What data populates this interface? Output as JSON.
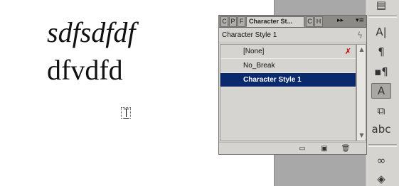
{
  "document": {
    "line1": "sdfsdfdf",
    "line2": "dfvdfd"
  },
  "panel": {
    "tabs": [
      {
        "label": "C"
      },
      {
        "label": "P"
      },
      {
        "label": "F"
      },
      {
        "label": "Character St..."
      },
      {
        "label": "C"
      },
      {
        "label": "H"
      }
    ],
    "expand_glyph": "▸▸",
    "menu_glyph": "▾≡",
    "current_style": "Character Style 1",
    "quick_apply_icon": "lightning-icon",
    "styles": [
      {
        "label": "[None]",
        "selected": false,
        "locked": true
      },
      {
        "label": "No_Break",
        "selected": false
      },
      {
        "label": "Character Style 1",
        "selected": true
      }
    ],
    "footer_icons": [
      "new-group-icon",
      "create-new-style-icon",
      "delete-style-icon"
    ]
  },
  "toolbar": {
    "icons": [
      "page-icon",
      "character-icon",
      "paragraph-icon",
      "paragraph-styles-icon",
      "character-styles-icon",
      "swatches-icon",
      "spell-check-icon",
      "links-icon",
      "layers-icon"
    ]
  },
  "colors": {
    "selection": "#0b2a6e",
    "panel_bg": "#d6d4d0",
    "pasteboard": "#a8a8a8"
  }
}
